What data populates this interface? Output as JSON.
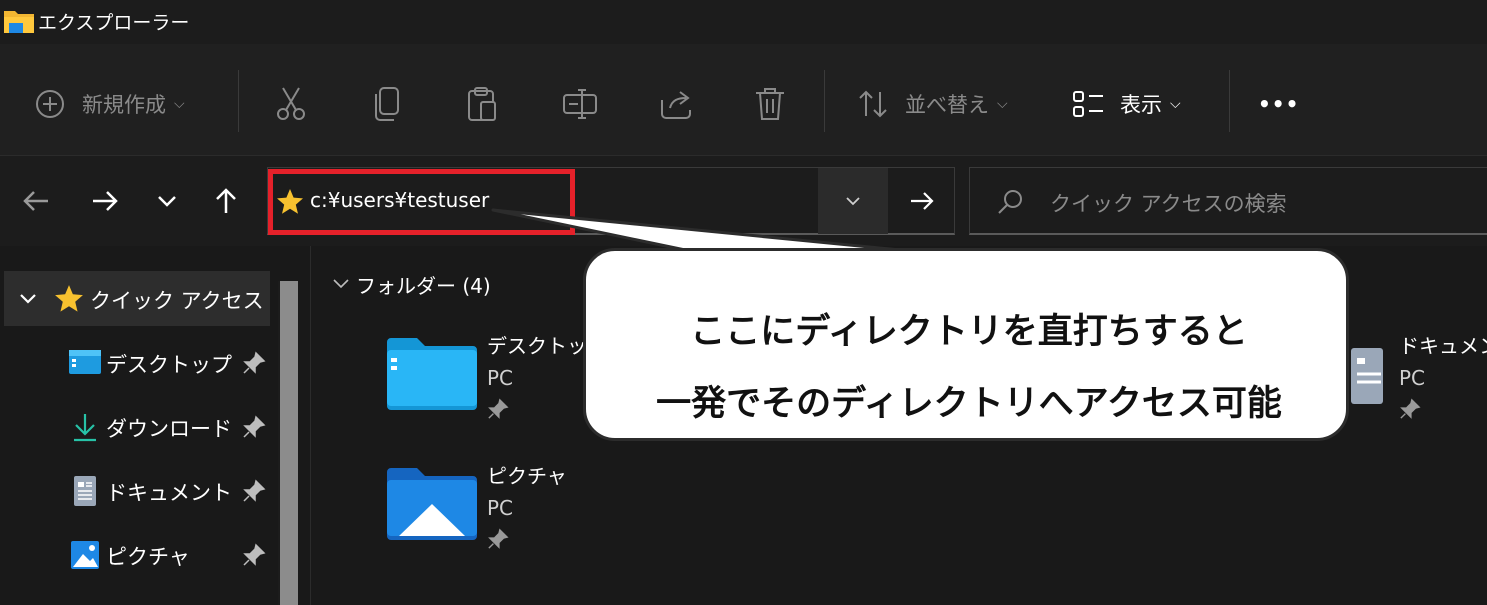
{
  "window": {
    "title": "エクスプローラー"
  },
  "toolbar": {
    "new_label": "新規作成",
    "sort_label": "並べ替え",
    "view_label": "表示",
    "more_label": "•••"
  },
  "address": {
    "path": "c:¥users¥testuser",
    "highlight_color": "#e5212a"
  },
  "search": {
    "placeholder": "クイック アクセスの検索"
  },
  "sidebar": {
    "quick_access_label": "クイック アクセス",
    "items": [
      {
        "label": "デスクトップ",
        "icon": "desktop-icon"
      },
      {
        "label": "ダウンロード",
        "icon": "download-icon"
      },
      {
        "label": "ドキュメント",
        "icon": "documents-icon"
      },
      {
        "label": "ピクチャ",
        "icon": "pictures-icon"
      }
    ]
  },
  "content": {
    "group_label": "フォルダー (4)",
    "tiles": [
      {
        "name": "デスクトップ",
        "location": "PC"
      },
      {
        "name": "ドキュメント",
        "location": "PC"
      },
      {
        "name": "ピクチャ",
        "location": "PC"
      }
    ]
  },
  "callout": {
    "line1": "ここにディレクトリを直打ちすると",
    "line2": "一発でそのディレクトリへアクセス可能"
  },
  "colors": {
    "accent": "#0078d4",
    "star": "#f7c12f",
    "background": "#191919"
  }
}
